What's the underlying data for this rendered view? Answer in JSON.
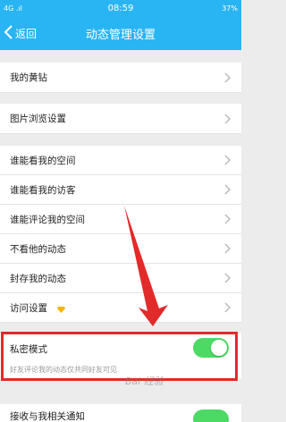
{
  "status": {
    "left": "4G .ıl",
    "time": "08:59",
    "right": "37%"
  },
  "header": {
    "back_label": "返回",
    "title": "动态管理设置"
  },
  "rows": {
    "yellow_diamond": "我的黄钻",
    "image_browse": "图片浏览设置",
    "who_see_space": "谁能看我的空间",
    "who_see_visitors": "谁能看我的访客",
    "who_comment": "谁能评论我的空间",
    "not_see": "不看他的动态",
    "blocked": "封存我的动态",
    "visit_settings": "访问设置"
  },
  "privacy": {
    "label": "私密模式",
    "description": "好友评论我的动态仅共同好友可见",
    "enabled": true
  },
  "bottom": {
    "label": "接收与我相关通知"
  },
  "watermark": "Bai 经验",
  "colors": {
    "header": "#29b5f3",
    "toggle_on": "#4cd964",
    "highlight": "#e22a2a"
  }
}
